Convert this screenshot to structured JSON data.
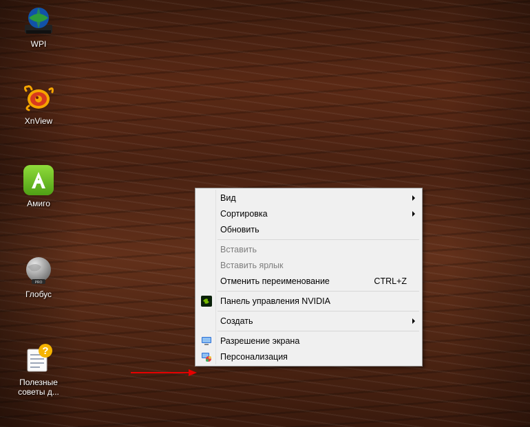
{
  "desktop_icons": [
    {
      "key": "wpi",
      "label": "WPI"
    },
    {
      "key": "xnview",
      "label": "XnView"
    },
    {
      "key": "amigo",
      "label": "Амиго"
    },
    {
      "key": "globus",
      "label": "Глобус"
    },
    {
      "key": "poleznye",
      "label": "Полезные советы д..."
    }
  ],
  "context_menu": {
    "view": {
      "label": "Вид"
    },
    "sort": {
      "label": "Сортировка"
    },
    "refresh": {
      "label": "Обновить"
    },
    "paste": {
      "label": "Вставить"
    },
    "paste_shortcut": {
      "label": "Вставить ярлык"
    },
    "undo_rename": {
      "label": "Отменить переименование",
      "shortcut": "CTRL+Z"
    },
    "nvidia": {
      "label": "Панель управления NVIDIA"
    },
    "create": {
      "label": "Создать"
    },
    "resolution": {
      "label": "Разрешение экрана"
    },
    "personalize": {
      "label": "Персонализация"
    }
  }
}
